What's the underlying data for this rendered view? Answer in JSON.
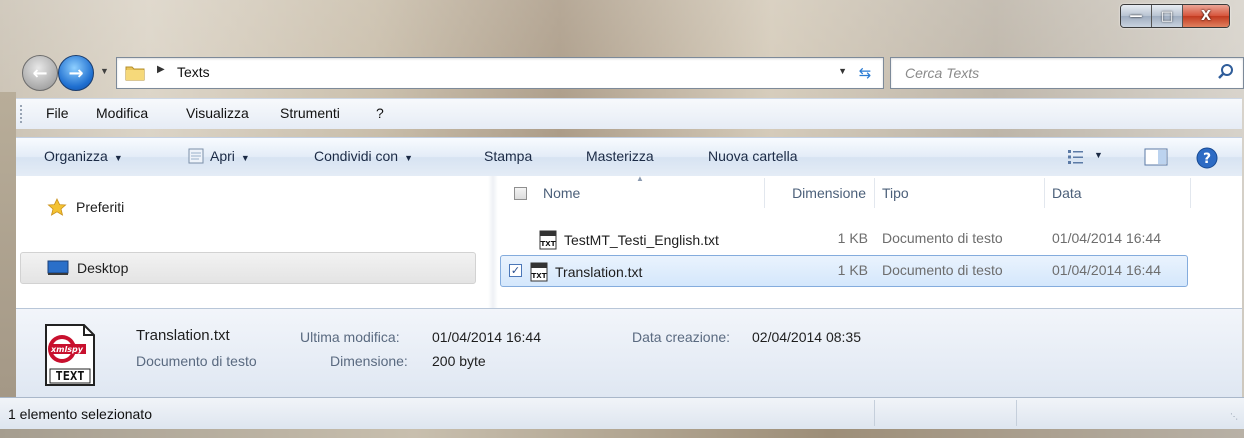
{
  "window": {
    "caption": {
      "minimize": "—",
      "maximize": "□",
      "close": "X"
    }
  },
  "address": {
    "path": "Texts",
    "search_placeholder": "Cerca Texts"
  },
  "menu": {
    "items": [
      "File",
      "Modifica",
      "Visualizza",
      "Strumenti",
      "?"
    ]
  },
  "toolbar": {
    "organize": "Organizza",
    "open": "Apri",
    "share": "Condividi con",
    "print": "Stampa",
    "burn": "Masterizza",
    "new_folder": "Nuova cartella"
  },
  "navpane": {
    "items": [
      {
        "label": "Preferiti",
        "icon": "star-icon"
      },
      {
        "label": "Desktop",
        "icon": "desktop-icon"
      }
    ]
  },
  "columns": {
    "name": "Nome",
    "size": "Dimensione",
    "type": "Tipo",
    "date": "Data"
  },
  "files": [
    {
      "name": "TestMT_Testi_English.txt",
      "size": "1 KB",
      "type": "Documento di testo",
      "date": "01/04/2014 16:44",
      "selected": false
    },
    {
      "name": "Translation.txt",
      "size": "1 KB",
      "type": "Documento di testo",
      "date": "01/04/2014 16:44",
      "selected": true
    }
  ],
  "details": {
    "icon_text": "TEXT",
    "icon_brand": "xmlspy",
    "filename": "Translation.txt",
    "filetype": "Documento di testo",
    "modified_label": "Ultima modifica:",
    "modified_value": "01/04/2014 16:44",
    "size_label": "Dimensione:",
    "size_value": "200 byte",
    "created_label": "Data creazione:",
    "created_value": "02/04/2014 08:35"
  },
  "status": {
    "text": "1 elemento selezionato"
  },
  "colors": {
    "selection": "#d4e7fc",
    "selection_border": "#84acdd",
    "toolbar_text": "#1b2a45"
  }
}
